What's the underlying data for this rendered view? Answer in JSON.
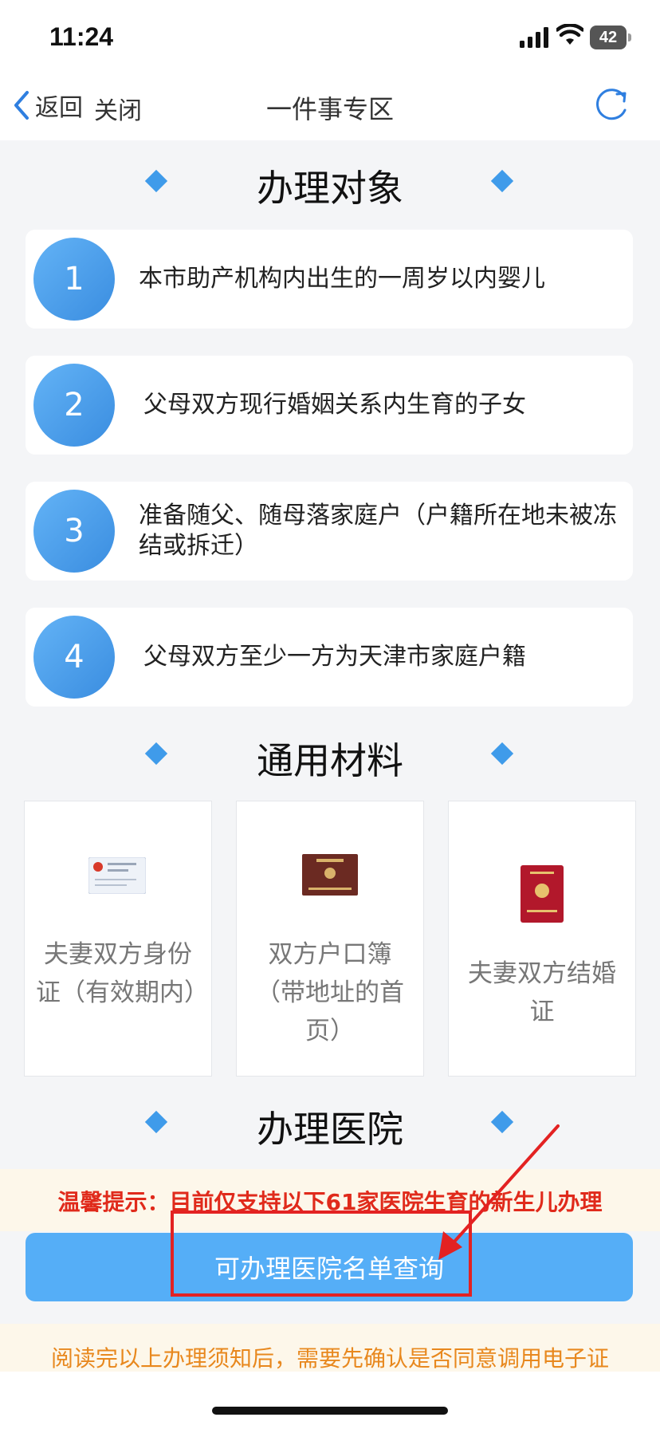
{
  "status_bar": {
    "time": "11:24",
    "battery": "42"
  },
  "nav": {
    "back_label": "返回",
    "close_label": "关闭",
    "title": "一件事专区"
  },
  "sections": {
    "targets_title": "办理对象",
    "materials_title": "通用材料",
    "hospitals_title": "办理医院"
  },
  "targets": [
    {
      "num": "1",
      "text": "本市助产机构内出生的一周岁以内婴儿"
    },
    {
      "num": "2",
      "text": "父母双方现行婚姻关系内生育的子女"
    },
    {
      "num": "3",
      "text": "准备随父、随母落家庭户（户籍所在地未被冻结或拆迁）"
    },
    {
      "num": "4",
      "text": "父母双方至少一方为天津市家庭户籍"
    }
  ],
  "materials": [
    {
      "label": "夫妻双方身份证（有效期内）",
      "icon": "id-card-icon"
    },
    {
      "label": "双方户口簿（带地址的首页）",
      "icon": "household-register-icon"
    },
    {
      "label": "夫妻双方结婚证",
      "icon": "marriage-certificate-icon"
    }
  ],
  "notice": "温馨提示：目前仅支持以下61家医院生育的新生儿办理",
  "query_button": "可办理医院名单查询",
  "bottom_notice": "阅读完以上办理须知后，需要先确认是否同意调用电子证",
  "colors": {
    "accent": "#55aef7",
    "circle": "#3a8de0",
    "notice_red": "#e02a1b",
    "bottom_orange": "#e8881e",
    "annotation_red": "#e32222"
  }
}
